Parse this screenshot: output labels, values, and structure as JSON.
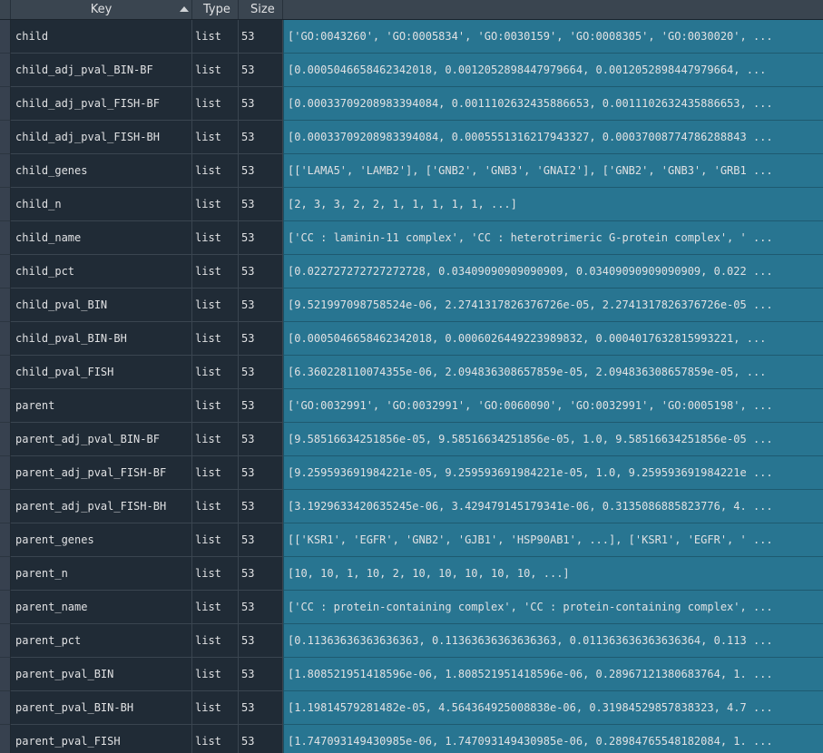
{
  "header": {
    "key": "Key",
    "type": "Type",
    "size": "Size",
    "value": ""
  },
  "colors": {
    "background": "#19232d",
    "header": "#3a4550",
    "row_bg": "#202b36",
    "value_bg": "#287591",
    "text": "#e0e1e3"
  },
  "rows": [
    {
      "key": "child",
      "type": "list",
      "size": "53",
      "value": "['GO:0043260', 'GO:0005834', 'GO:0030159', 'GO:0008305', 'GO:0030020', ..."
    },
    {
      "key": "child_adj_pval_BIN-BF",
      "type": "list",
      "size": "53",
      "value": "[0.0005046658462342018, 0.0012052898447979664, 0.0012052898447979664, ..."
    },
    {
      "key": "child_adj_pval_FISH-BF",
      "type": "list",
      "size": "53",
      "value": "[0.00033709208983394084, 0.0011102632435886653, 0.0011102632435886653, ..."
    },
    {
      "key": "child_adj_pval_FISH-BH",
      "type": "list",
      "size": "53",
      "value": "[0.00033709208983394084, 0.0005551316217943327, 0.00037008774786288843 ..."
    },
    {
      "key": "child_genes",
      "type": "list",
      "size": "53",
      "value": "[['LAMA5', 'LAMB2'], ['GNB2', 'GNB3', 'GNAI2'], ['GNB2', 'GNB3', 'GRB1 ..."
    },
    {
      "key": "child_n",
      "type": "list",
      "size": "53",
      "value": "[2, 3, 3, 2, 2, 1, 1, 1, 1, 1, ...]"
    },
    {
      "key": "child_name",
      "type": "list",
      "size": "53",
      "value": "['CC : laminin-11 complex', 'CC : heterotrimeric G-protein complex', ' ..."
    },
    {
      "key": "child_pct",
      "type": "list",
      "size": "53",
      "value": "[0.022727272727272728, 0.03409090909090909, 0.03409090909090909, 0.022 ..."
    },
    {
      "key": "child_pval_BIN",
      "type": "list",
      "size": "53",
      "value": "[9.521997098758524e-06, 2.2741317826376726e-05, 2.2741317826376726e-05 ..."
    },
    {
      "key": "child_pval_BIN-BH",
      "type": "list",
      "size": "53",
      "value": "[0.0005046658462342018, 0.0006026449223989832, 0.0004017632815993221, ..."
    },
    {
      "key": "child_pval_FISH",
      "type": "list",
      "size": "53",
      "value": "[6.360228110074355e-06, 2.094836308657859e-05, 2.094836308657859e-05, ..."
    },
    {
      "key": "parent",
      "type": "list",
      "size": "53",
      "value": "['GO:0032991', 'GO:0032991', 'GO:0060090', 'GO:0032991', 'GO:0005198', ..."
    },
    {
      "key": "parent_adj_pval_BIN-BF",
      "type": "list",
      "size": "53",
      "value": "[9.58516634251856e-05, 9.58516634251856e-05, 1.0, 9.58516634251856e-05 ..."
    },
    {
      "key": "parent_adj_pval_FISH-BF",
      "type": "list",
      "size": "53",
      "value": "[9.259593691984221e-05, 9.259593691984221e-05, 1.0, 9.259593691984221e ..."
    },
    {
      "key": "parent_adj_pval_FISH-BH",
      "type": "list",
      "size": "53",
      "value": "[3.1929633420635245e-06, 3.429479145179341e-06, 0.3135086885823776, 4. ..."
    },
    {
      "key": "parent_genes",
      "type": "list",
      "size": "53",
      "value": "[['KSR1', 'EGFR', 'GNB2', 'GJB1', 'HSP90AB1', ...], ['KSR1', 'EGFR', ' ..."
    },
    {
      "key": "parent_n",
      "type": "list",
      "size": "53",
      "value": "[10, 10, 1, 10, 2, 10, 10, 10, 10, 10, ...]"
    },
    {
      "key": "parent_name",
      "type": "list",
      "size": "53",
      "value": "['CC : protein-containing complex', 'CC : protein-containing complex', ..."
    },
    {
      "key": "parent_pct",
      "type": "list",
      "size": "53",
      "value": "[0.11363636363636363, 0.11363636363636363, 0.011363636363636364, 0.113 ..."
    },
    {
      "key": "parent_pval_BIN",
      "type": "list",
      "size": "53",
      "value": "[1.808521951418596e-06, 1.808521951418596e-06, 0.28967121380683764, 1. ..."
    },
    {
      "key": "parent_pval_BIN-BH",
      "type": "list",
      "size": "53",
      "value": "[1.19814579281482e-05, 4.564364925008838e-06, 0.31984529857838323, 4.7 ..."
    },
    {
      "key": "parent_pval_FISH",
      "type": "list",
      "size": "53",
      "value": "[1.747093149430985e-06, 1.747093149430985e-06, 0.28984765548182084, 1. ..."
    }
  ]
}
